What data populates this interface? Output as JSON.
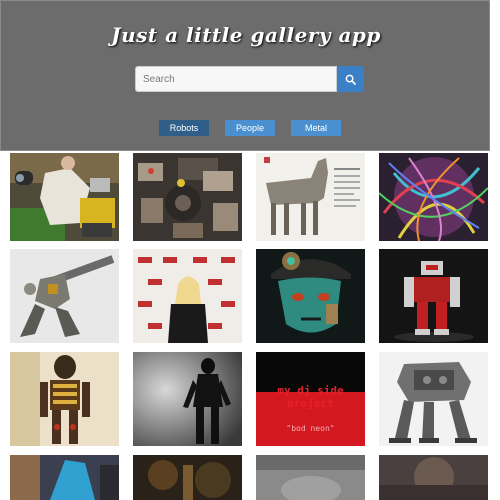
{
  "header": {
    "title": "Just a little gallery app",
    "search_placeholder": "Search"
  },
  "tags": [
    {
      "label": "Robots",
      "active": true
    },
    {
      "label": "People",
      "active": false
    },
    {
      "label": "Metal",
      "active": false
    }
  ],
  "gallery": {
    "tiles": [
      {
        "name": "robot-walle-photo"
      },
      {
        "name": "robot-gear-assembly-photo"
      },
      {
        "name": "robot-horse-drawing-photo"
      },
      {
        "name": "colorful-wire-sphere-photo"
      },
      {
        "name": "robot-mech-rifle-photo"
      },
      {
        "name": "person-convention-backdrop-photo"
      },
      {
        "name": "steampunk-face-art-photo"
      },
      {
        "name": "red-white-robot-photo"
      },
      {
        "name": "humanoid-robot-skeleton-photo"
      },
      {
        "name": "robot-silhouette-photo"
      },
      {
        "name": "side-project-text-photo",
        "text_top": "my dj side project",
        "text_bottom": "\"bod neon\""
      },
      {
        "name": "mech-walker-photo"
      },
      {
        "name": "partial-blue-photo"
      },
      {
        "name": "partial-dark-photo"
      },
      {
        "name": "partial-gray-photo"
      },
      {
        "name": "partial-dim-photo"
      }
    ]
  },
  "colors": {
    "header_bg": "#6c6c6c",
    "accent": "#3b80c6",
    "tag_active": "#2f5f88",
    "tag_normal": "#4a90d0"
  }
}
